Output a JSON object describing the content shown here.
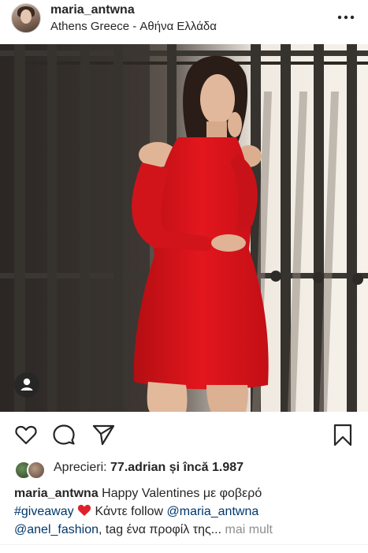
{
  "post": {
    "username": "maria_antwna",
    "location": "Athens Greece - Αθήνα Ελλάδα"
  },
  "icons": {
    "more": "more-icon",
    "like": "heart-icon",
    "comment": "comment-icon",
    "share": "send-icon",
    "save": "bookmark-icon",
    "user_tag": "person-icon"
  },
  "likes": {
    "label": "Aprecieri:",
    "user": "77.adrian",
    "connector": "și încă",
    "count": "1.987"
  },
  "caption": {
    "username": "maria_antwna",
    "text1": "Happy Valentines με φοβερό",
    "hashtag": "#giveaway",
    "emoji": "heart",
    "text2": "Κάντε follow",
    "mention1": "@maria_antwna",
    "mention2": "@anel_fashion",
    "text3": ", tag ένα προφίλ της...",
    "more_label": "mai mult"
  },
  "colors": {
    "text": "#262626",
    "link": "#00376b",
    "muted": "#8e8e8e",
    "dress": "#d8141b",
    "heart": "#ed4956"
  }
}
